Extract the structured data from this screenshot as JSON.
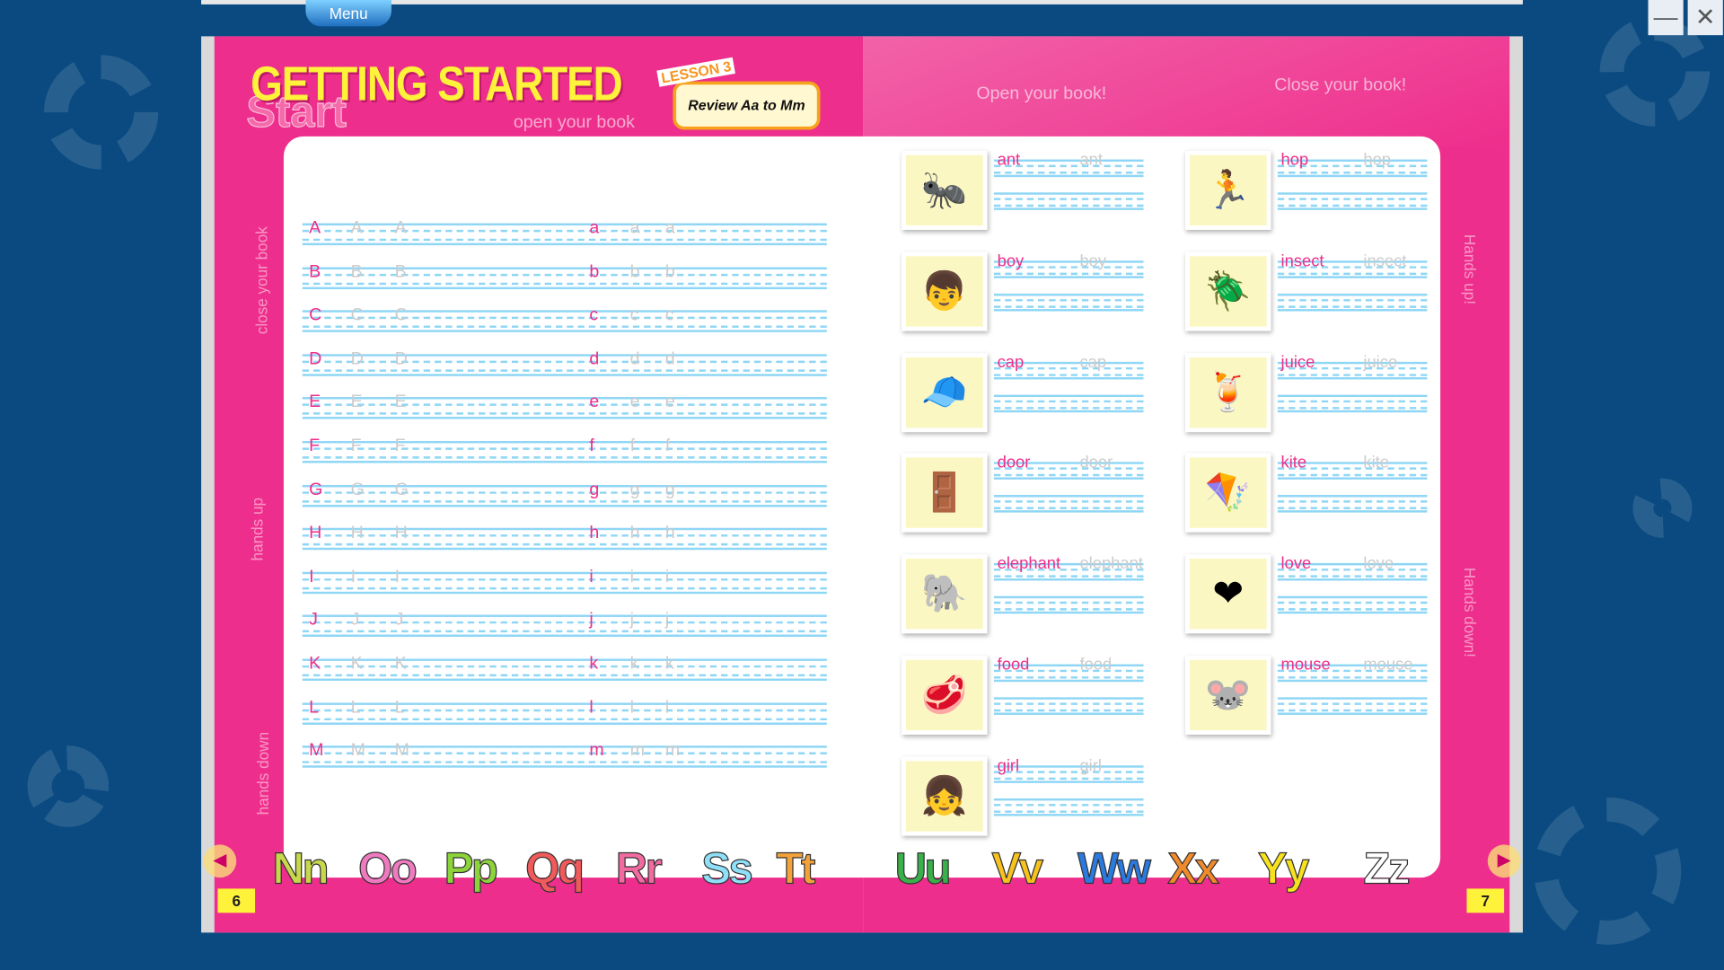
{
  "window": {
    "menu_label": "Menu",
    "minimize_label": "—",
    "close_label": "✕"
  },
  "header": {
    "title": "GETTING STARTED",
    "ghost_word": "Start",
    "lesson_tag": "LESSON 3",
    "lesson_title": "Review Aa to Mm",
    "left_subtitle": "open your book",
    "right_open": "Open your book!",
    "right_close": "Close your book!"
  },
  "side_labels": {
    "left": [
      "close your book",
      "hands up",
      "hands down"
    ],
    "right": [
      "Hands up!",
      "Hands down!"
    ]
  },
  "letters": [
    {
      "upper": "A",
      "lower": "a"
    },
    {
      "upper": "B",
      "lower": "b"
    },
    {
      "upper": "C",
      "lower": "c"
    },
    {
      "upper": "D",
      "lower": "d"
    },
    {
      "upper": "E",
      "lower": "e"
    },
    {
      "upper": "F",
      "lower": "f"
    },
    {
      "upper": "G",
      "lower": "g"
    },
    {
      "upper": "H",
      "lower": "h"
    },
    {
      "upper": "I",
      "lower": "i"
    },
    {
      "upper": "J",
      "lower": "j"
    },
    {
      "upper": "K",
      "lower": "k"
    },
    {
      "upper": "L",
      "lower": "l"
    },
    {
      "upper": "M",
      "lower": "m"
    }
  ],
  "words": [
    {
      "word": "ant",
      "icon": "ant-icon",
      "glyph": "🐜"
    },
    {
      "word": "boy",
      "icon": "boy-icon",
      "glyph": "👦"
    },
    {
      "word": "cap",
      "icon": "cap-icon",
      "glyph": "🧢"
    },
    {
      "word": "door",
      "icon": "door-icon",
      "glyph": "🚪"
    },
    {
      "word": "elephant",
      "icon": "elephant-icon",
      "glyph": "🐘"
    },
    {
      "word": "food",
      "icon": "food-icon",
      "glyph": "🥩"
    },
    {
      "word": "girl",
      "icon": "girl-icon",
      "glyph": "👧"
    },
    {
      "word": "hop",
      "icon": "hopscotch-icon",
      "glyph": "🏃"
    },
    {
      "word": "insect",
      "icon": "beetle-icon",
      "glyph": "🪲"
    },
    {
      "word": "juice",
      "icon": "juice-icon",
      "glyph": "🍹"
    },
    {
      "word": "kite",
      "icon": "kite-icon",
      "glyph": "🪁"
    },
    {
      "word": "love",
      "icon": "heart-icon",
      "glyph": "❤"
    },
    {
      "word": "mouse",
      "icon": "mouse-icon",
      "glyph": "🐭"
    }
  ],
  "alphabet_strip": [
    {
      "text": "Nn",
      "color": "#c8d84a"
    },
    {
      "text": "Oo",
      "color": "#f07ac0"
    },
    {
      "text": "Pp",
      "color": "#8cd43a"
    },
    {
      "text": "Qq",
      "color": "#f05a5a"
    },
    {
      "text": "Rr",
      "color": "#f26aa0"
    },
    {
      "text": "Ss",
      "color": "#8ee0f8"
    },
    {
      "text": "Tt",
      "color": "#f3a23a"
    },
    {
      "text": "Uu",
      "color": "#3ab04a"
    },
    {
      "text": "Vv",
      "color": "#f7c21d"
    },
    {
      "text": "Ww",
      "color": "#2a7ae0"
    },
    {
      "text": "Xx",
      "color": "#f08a2a"
    },
    {
      "text": "Yy",
      "color": "#f7e21d"
    },
    {
      "text": "Zz",
      "color": "#ffffff"
    }
  ],
  "pages": {
    "left": "6",
    "right": "7"
  },
  "colors": {
    "page": "#ee2e8c",
    "title": "#fff23a",
    "background": "#0a4a80",
    "guide_lines": "#8ed6f5"
  }
}
